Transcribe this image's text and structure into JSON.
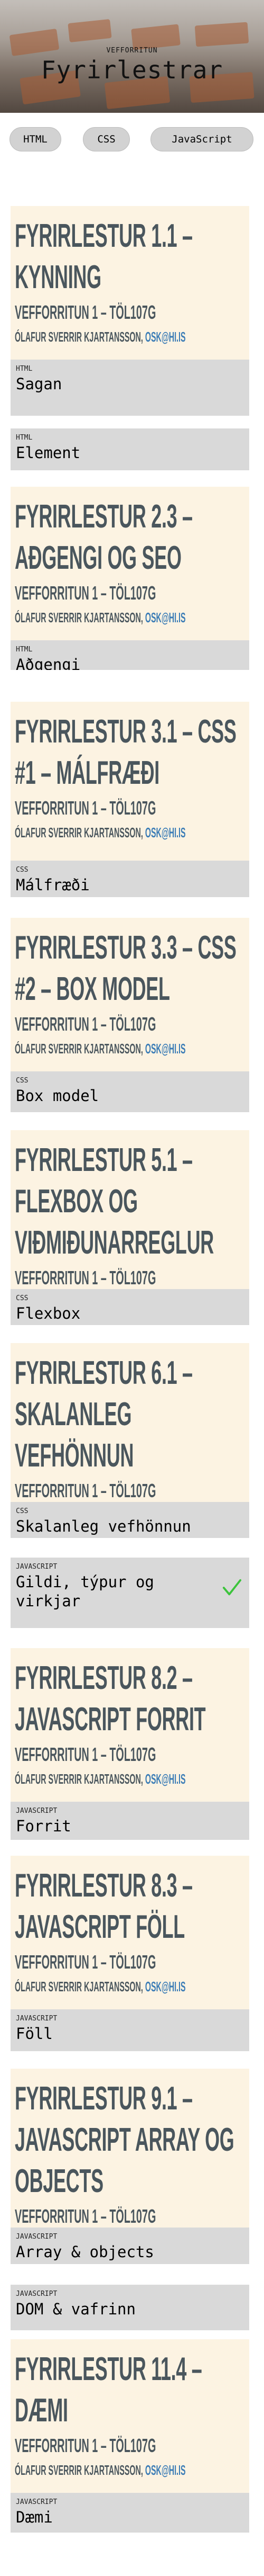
{
  "header": {
    "subtitle": "VEFFORRITUN",
    "title": "Fyrirlestrar"
  },
  "tabs": [
    {
      "label": "HTML"
    },
    {
      "label": "CSS"
    },
    {
      "label": "JavaScript"
    }
  ],
  "course_line": "Vefforritun 1 – TÖL107G",
  "author": "Ólafur Sverrir Kjartansson, ",
  "author_email": "osk@hi.is",
  "lectures": [
    {
      "title": "Fyrirlestur 1.1 – Kynning",
      "category": "HTML",
      "name": "Sagan"
    },
    {
      "title": "",
      "category": "HTML",
      "name": "Element"
    },
    {
      "title": "Fyrirlestur 2.3 – Aðgengi og SEO",
      "category": "HTML",
      "name": "Aðgengi"
    },
    {
      "title": "Fyrirlestur 3.1 – CSS #1 – Málfræði",
      "category": "CSS",
      "name": "Málfræði"
    },
    {
      "title": "Fyrirlestur 3.3 – CSS #2 – Box model",
      "category": "CSS",
      "name": "Box model"
    },
    {
      "title": "Fyrirlestur 5.1 – Flexbox og viðmiðunarreglur",
      "category": "CSS",
      "name": "Flexbox"
    },
    {
      "title": "Fyrirlestur 6.1 – Skalanleg vefhönnun",
      "category": "CSS",
      "name": "Skalanleg vefhönnun"
    },
    {
      "title": "",
      "category": "JAVASCRIPT",
      "name": "Gildi, týpur og virkjar",
      "done": true
    },
    {
      "title": "Fyrirlestur 8.2 – JavaScript forrit",
      "category": "JAVASCRIPT",
      "name": "Forrit"
    },
    {
      "title": "Fyrirlestur 8.3 – JavaScript föll",
      "category": "JAVASCRIPT",
      "name": "Föll"
    },
    {
      "title": "Fyrirlestur 9.1 – JavaScript array og objects",
      "category": "JAVASCRIPT",
      "name": "Array & objects"
    },
    {
      "title": "",
      "category": "JAVASCRIPT",
      "name": "DOM & vafrinn"
    },
    {
      "title": "Fyrirlestur 11.4 – Dæmi",
      "category": "JAVASCRIPT",
      "name": "Dæmi"
    }
  ],
  "colors": {
    "slide_bg": "#fcf3e2",
    "slide_text": "#4a565d",
    "email": "#3c7db6",
    "label_bg": "#d9d9d9",
    "tab_bg": "#d2d2d2",
    "check": "#3cc43c"
  },
  "icons": {
    "done": "checkmark-icon"
  }
}
